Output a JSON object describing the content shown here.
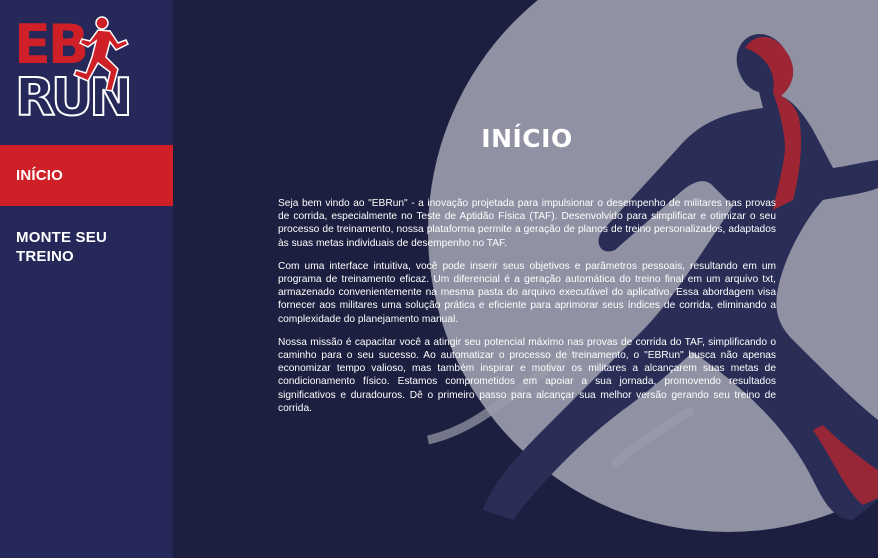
{
  "app": {
    "logo_text_top": "EB",
    "logo_text_bottom": "RUN"
  },
  "colors": {
    "sidebar_bg": "#26285a",
    "main_bg": "#1c1f3f",
    "accent_red": "#cf2027",
    "text": "#ffffff"
  },
  "sidebar": {
    "items": [
      {
        "label": "INÍCIO",
        "active": true
      },
      {
        "label": "MONTE SEU TREINO",
        "active": false
      }
    ]
  },
  "main": {
    "title": "INÍCIO",
    "paragraphs": [
      "Seja bem vindo ao \"EBRun\" - a inovação projetada para impulsionar o desempenho de militares nas provas de corrida, especialmente no Teste de Aptidão Física (TAF). Desenvolvido para simplificar e otimizar o seu processo de treinamento, nossa plataforma permite a geração de planos de treino personalizados, adaptados às suas metas individuais de desempenho no TAF.",
      "Com uma interface intuitiva, você pode inserir seus objetivos e parâmetros pessoais, resultando em um programa de treinamento eficaz. Um diferencial é a geração automática do treino final em um arquivo txt, armazenado convenientemente na mesma pasta do arquivo executável do aplicativo. Essa abordagem visa fornecer aos militares uma solução prática e eficiente para aprimorar seus índices de corrida, eliminando a complexidade do planejamento manual.",
      "Nossa missão é capacitar você a atingir seu potencial máximo nas provas de corrida do TAF, simplificando o caminho para o seu sucesso. Ao automatizar o processo de treinamento, o \"EBRun\" busca não apenas economizar tempo valioso, mas também inspirar e motivar os militares a alcançarem suas metas de condicionamento físico. Estamos comprometidos em apoiar a sua jornada, promovendo resultados significativos e duradouros. Dê o primeiro passo para alcançar sua melhor versão gerando seu treino de corrida."
    ]
  }
}
